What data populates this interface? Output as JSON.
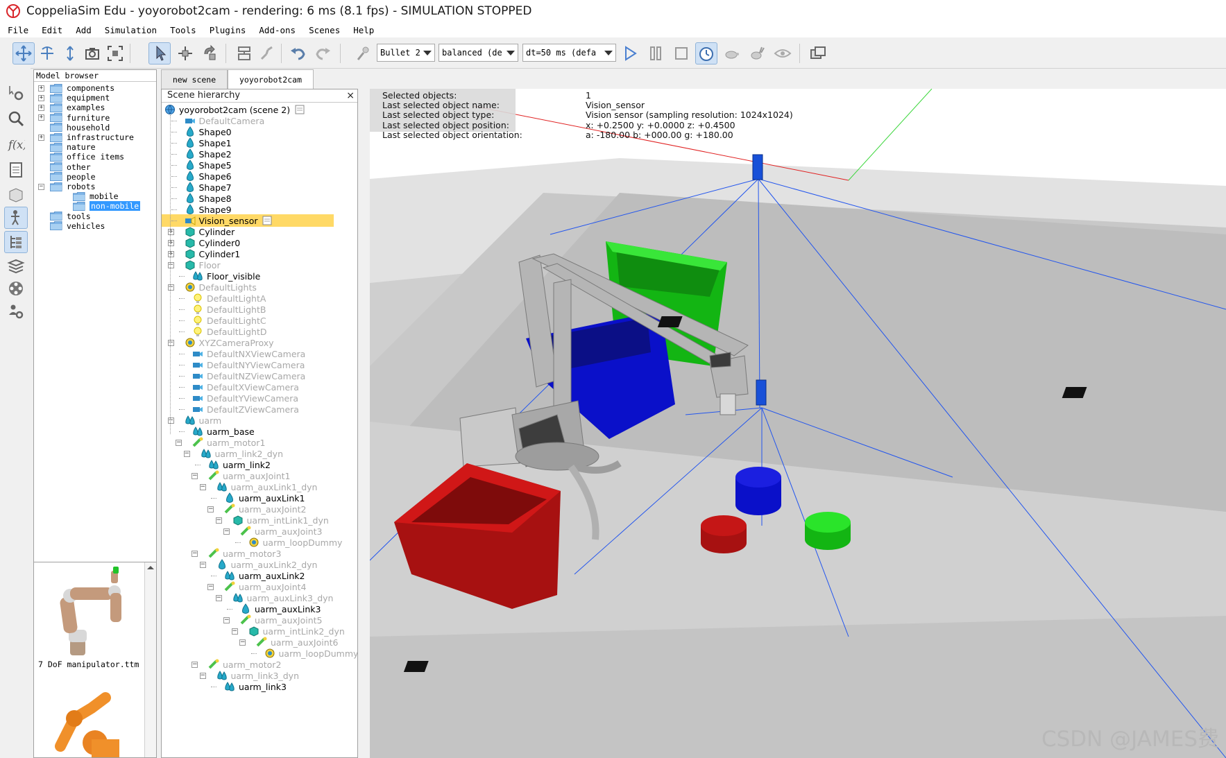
{
  "window": {
    "title": "CoppeliaSim Edu - yoyorobot2cam - rendering: 6 ms (8.1 fps) - SIMULATION STOPPED"
  },
  "menu": [
    "File",
    "Edit",
    "Add",
    "Simulation",
    "Tools",
    "Plugins",
    "Add-ons",
    "Scenes",
    "Help"
  ],
  "toolbar": {
    "engine": "Bullet 2",
    "accuracy": "balanced (de",
    "timestep": "dt=50 ms (defa"
  },
  "model_browser": {
    "header": "Model browser",
    "items": [
      {
        "label": "components",
        "expandable": true
      },
      {
        "label": "equipment",
        "expandable": true
      },
      {
        "label": "examples",
        "expandable": true
      },
      {
        "label": "furniture",
        "expandable": true
      },
      {
        "label": "household",
        "expandable": false
      },
      {
        "label": "infrastructure",
        "expandable": true
      },
      {
        "label": "nature",
        "expandable": false
      },
      {
        "label": "office items",
        "expandable": false
      },
      {
        "label": "other",
        "expandable": false
      },
      {
        "label": "people",
        "expandable": false
      },
      {
        "label": "robots",
        "expandable": true,
        "expanded": true
      },
      {
        "label": "mobile",
        "child": true
      },
      {
        "label": "non-mobile",
        "child": true,
        "selected": true
      },
      {
        "label": "tools",
        "expandable": false
      },
      {
        "label": "vehicles",
        "expandable": false
      }
    ],
    "thumbnail_caption": "7 DoF manipulator.ttm"
  },
  "tabs": [
    "new scene",
    "yoyorobot2cam"
  ],
  "active_tab": "yoyorobot2cam",
  "hierarchy": {
    "header": "Scene hierarchy",
    "close": "×",
    "root": "yoyorobot2cam (scene 2)",
    "rows": [
      {
        "label": "DefaultCamera",
        "level": 1,
        "icon": "camera",
        "dim": true
      },
      {
        "label": "Shape0",
        "level": 1,
        "icon": "shape"
      },
      {
        "label": "Shape1",
        "level": 1,
        "icon": "shape"
      },
      {
        "label": "Shape2",
        "level": 1,
        "icon": "shape"
      },
      {
        "label": "Shape5",
        "level": 1,
        "icon": "shape"
      },
      {
        "label": "Shape6",
        "level": 1,
        "icon": "shape"
      },
      {
        "label": "Shape7",
        "level": 1,
        "icon": "shape"
      },
      {
        "label": "Shape8",
        "level": 1,
        "icon": "shape"
      },
      {
        "label": "Shape9",
        "level": 1,
        "icon": "shape"
      },
      {
        "label": "Vision_sensor",
        "level": 1,
        "icon": "sensor",
        "selected": true
      },
      {
        "label": "Cylinder",
        "level": 1,
        "icon": "cube",
        "exp": "+"
      },
      {
        "label": "Cylinder0",
        "level": 1,
        "icon": "cube",
        "exp": "+"
      },
      {
        "label": "Cylinder1",
        "level": 1,
        "icon": "cube",
        "exp": "+"
      },
      {
        "label": "Floor",
        "level": 1,
        "icon": "cube",
        "exp": "-",
        "dim": true
      },
      {
        "label": "Floor_visible",
        "level": 2,
        "icon": "multishape"
      },
      {
        "label": "DefaultLights",
        "level": 1,
        "icon": "dummy",
        "exp": "-",
        "dim": true
      },
      {
        "label": "DefaultLightA",
        "level": 2,
        "icon": "light",
        "dim": true
      },
      {
        "label": "DefaultLightB",
        "level": 2,
        "icon": "light",
        "dim": true
      },
      {
        "label": "DefaultLightC",
        "level": 2,
        "icon": "light",
        "dim": true
      },
      {
        "label": "DefaultLightD",
        "level": 2,
        "icon": "light",
        "dim": true
      },
      {
        "label": "XYZCameraProxy",
        "level": 1,
        "icon": "dummy",
        "exp": "-",
        "dim": true
      },
      {
        "label": "DefaultNXViewCamera",
        "level": 2,
        "icon": "camera",
        "dim": true
      },
      {
        "label": "DefaultNYViewCamera",
        "level": 2,
        "icon": "camera",
        "dim": true
      },
      {
        "label": "DefaultNZViewCamera",
        "level": 2,
        "icon": "camera",
        "dim": true
      },
      {
        "label": "DefaultXViewCamera",
        "level": 2,
        "icon": "camera",
        "dim": true
      },
      {
        "label": "DefaultYViewCamera",
        "level": 2,
        "icon": "camera",
        "dim": true
      },
      {
        "label": "DefaultZViewCamera",
        "level": 2,
        "icon": "camera",
        "dim": true
      },
      {
        "label": "uarm",
        "level": 1,
        "icon": "multishape",
        "exp": "-",
        "dim": true
      },
      {
        "label": "uarm_base",
        "level": 2,
        "icon": "multishape"
      },
      {
        "label": "uarm_motor1",
        "level": 2,
        "icon": "joint",
        "exp": "-",
        "dim": true
      },
      {
        "label": "uarm_link2_dyn",
        "level": 3,
        "icon": "multishape",
        "exp": "-",
        "dim": true
      },
      {
        "label": "uarm_link2",
        "level": 4,
        "icon": "multishape"
      },
      {
        "label": "uarm_auxJoint1",
        "level": 4,
        "icon": "joint",
        "exp": "-",
        "dim": true
      },
      {
        "label": "uarm_auxLink1_dyn",
        "level": 5,
        "icon": "multishape",
        "exp": "-",
        "dim": true
      },
      {
        "label": "uarm_auxLink1",
        "level": 6,
        "icon": "shape"
      },
      {
        "label": "uarm_auxJoint2",
        "level": 6,
        "icon": "joint",
        "exp": "-",
        "dim": true
      },
      {
        "label": "uarm_intLink1_dyn",
        "level": 7,
        "icon": "cube",
        "exp": "-",
        "dim": true
      },
      {
        "label": "uarm_auxJoint3",
        "level": 8,
        "icon": "joint",
        "exp": "-",
        "dim": true
      },
      {
        "label": "uarm_loopDummy",
        "level": 9,
        "icon": "dummy",
        "dim": true
      },
      {
        "label": "uarm_motor3",
        "level": 4,
        "icon": "joint",
        "exp": "-",
        "dim": true
      },
      {
        "label": "uarm_auxLink2_dyn",
        "level": 5,
        "icon": "shape",
        "exp": "-",
        "dim": true
      },
      {
        "label": "uarm_auxLink2",
        "level": 6,
        "icon": "multishape"
      },
      {
        "label": "uarm_auxJoint4",
        "level": 6,
        "icon": "joint",
        "exp": "-",
        "dim": true
      },
      {
        "label": "uarm_auxLink3_dyn",
        "level": 7,
        "icon": "multishape",
        "exp": "-",
        "dim": true
      },
      {
        "label": "uarm_auxLink3",
        "level": 8,
        "icon": "shape"
      },
      {
        "label": "uarm_auxJoint5",
        "level": 8,
        "icon": "joint",
        "exp": "-",
        "dim": true
      },
      {
        "label": "uarm_intLink2_dyn",
        "level": 9,
        "icon": "cube",
        "exp": "-",
        "dim": true
      },
      {
        "label": "uarm_auxJoint6",
        "level": 10,
        "icon": "joint",
        "exp": "-",
        "dim": true
      },
      {
        "label": "uarm_loopDummy",
        "level": 11,
        "icon": "dummy",
        "dim": true
      },
      {
        "label": "uarm_motor2",
        "level": 4,
        "icon": "joint",
        "exp": "-",
        "dim": true
      },
      {
        "label": "uarm_link3_dyn",
        "level": 5,
        "icon": "multishape",
        "exp": "-",
        "dim": true
      },
      {
        "label": "uarm_link3",
        "level": 6,
        "icon": "multishape"
      }
    ]
  },
  "info": [
    {
      "key": "Selected objects:",
      "value": "1"
    },
    {
      "key": "Last selected object name:",
      "value": "Vision_sensor"
    },
    {
      "key": "Last selected object type:",
      "value": "Vision sensor (sampling resolution: 1024x1024)"
    },
    {
      "key": "Last selected object position:",
      "value": "x: +0.2500   y: +0.0000   z: +0.4500"
    },
    {
      "key": "Last selected object orientation:",
      "value": "a: -180.00   b: +000.00   g: +180.00"
    }
  ],
  "watermark": "CSDN @JAMES费",
  "colors": {
    "accent": "#3399ff",
    "selection": "#ffd966",
    "red_bin": "#e0191c",
    "green_bin": "#1fd81f",
    "blue_bin": "#0a10c9"
  }
}
